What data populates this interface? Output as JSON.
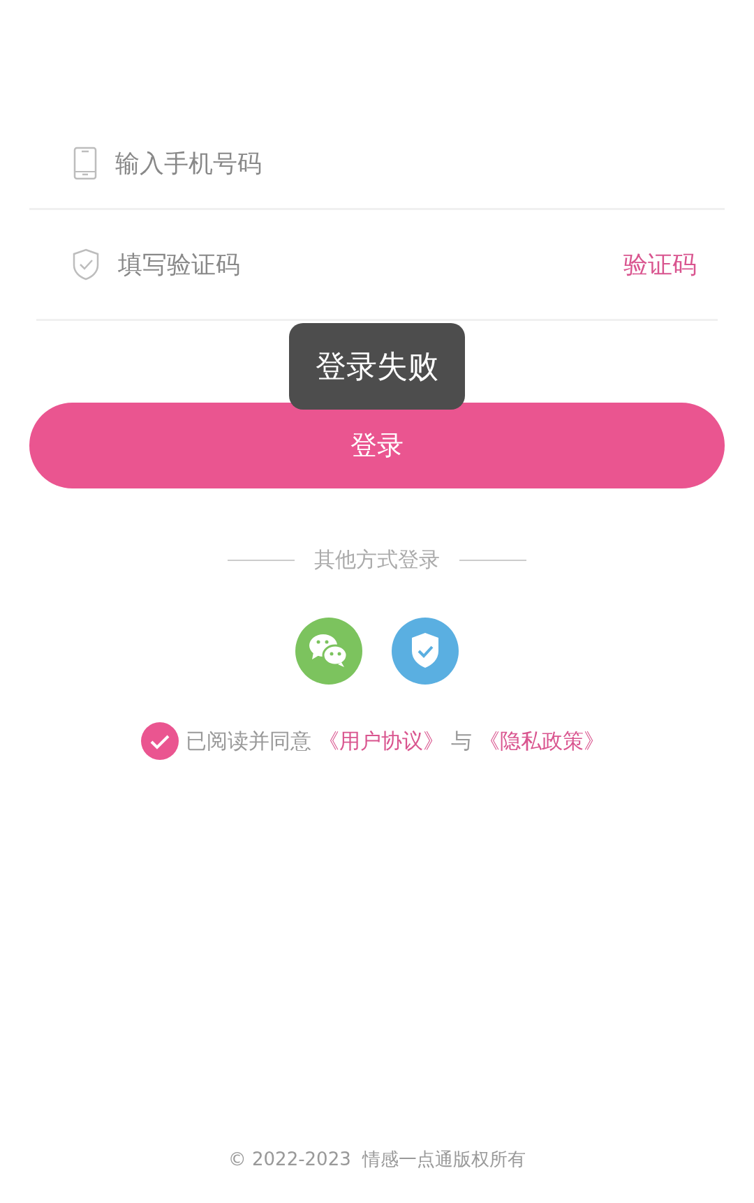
{
  "phone_field": {
    "placeholder": "输入手机号码"
  },
  "code_field": {
    "placeholder": "填写验证码"
  },
  "code_button": "验证码",
  "toast": "登录失败",
  "login_button": "登录",
  "other_login": {
    "title": "其他方式登录",
    "options": [
      {
        "kind": "wechat",
        "color": "#7cc35e"
      },
      {
        "kind": "shield",
        "color": "#5aafe1"
      }
    ]
  },
  "agreement": {
    "agreed": true,
    "text": "已阅读并同意",
    "link1": "《用户协议》",
    "joiner": "与",
    "link2": "《隐私政策》"
  },
  "footer": "© 2022-2023  情感一点通版权所有"
}
